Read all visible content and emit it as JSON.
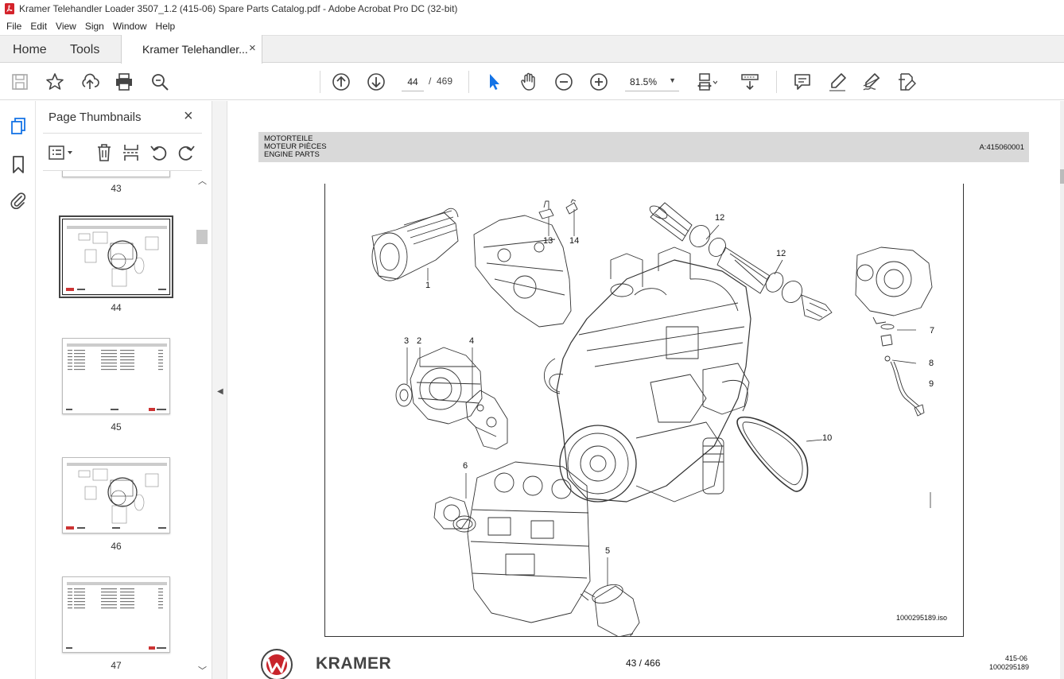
{
  "window": {
    "title": "Kramer Telehandler Loader 3507_1.2 (415-06) Spare Parts Catalog.pdf - Adobe Acrobat Pro DC (32-bit)"
  },
  "menu": [
    "File",
    "Edit",
    "View",
    "Sign",
    "Window",
    "Help"
  ],
  "tabs": {
    "home": "Home",
    "tools": "Tools",
    "document": "Kramer Telehandler...",
    "close": "×"
  },
  "toolbar": {
    "current_page": "44",
    "page_sep": "/",
    "total_pages": "469",
    "zoom": "81.5%"
  },
  "panel": {
    "title": "Page Thumbnails",
    "close": "×",
    "thumbnails": [
      {
        "label": "43",
        "kind": "cut"
      },
      {
        "label": "44",
        "kind": "diagram",
        "selected": true
      },
      {
        "label": "45",
        "kind": "table"
      },
      {
        "label": "46",
        "kind": "diagram"
      },
      {
        "label": "47",
        "kind": "table"
      }
    ]
  },
  "page": {
    "header_lines": [
      "MOTORTEILE",
      "MOTEUR PIÈCES",
      "ENGINE PARTS"
    ],
    "header_code": "A:415060001",
    "callouts": [
      "1",
      "2",
      "3",
      "4",
      "5",
      "6",
      "7",
      "8",
      "9",
      "10",
      "12",
      "12",
      "13",
      "14"
    ],
    "iso_id": "1000295189.iso",
    "page_indicator": "43 / 466",
    "brand": "KRAMER",
    "footer_code": "415-06",
    "footer_id": "1000295189"
  },
  "colors": {
    "acrobat_red": "#d4232b",
    "selection_blue": "#1473e6",
    "header_gray": "#d9d9d9"
  }
}
